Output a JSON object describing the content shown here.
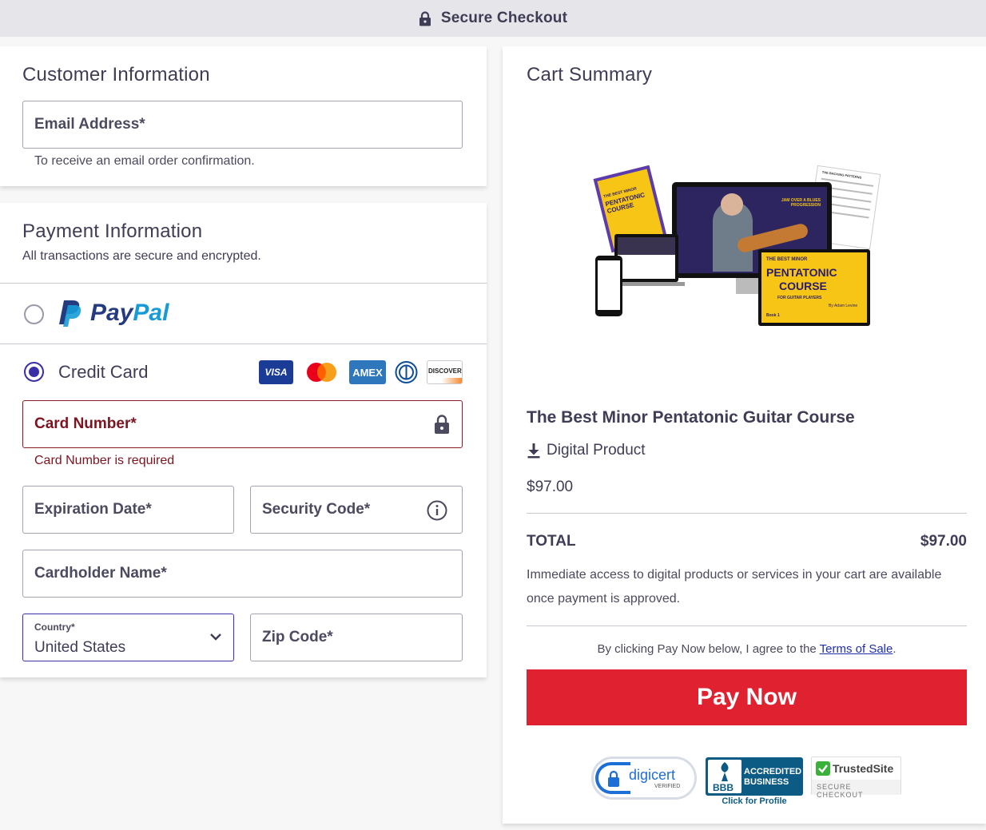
{
  "topbar": {
    "title": "Secure Checkout",
    "icon": "lock-icon"
  },
  "customer": {
    "heading": "Customer Information",
    "email_placeholder": "Email Address*",
    "email_note": "To receive an email order confirmation."
  },
  "payment": {
    "heading": "Payment Information",
    "subheading": "All transactions are secure and encrypted.",
    "paypal_label": "PayPal",
    "credit_card_label": "Credit Card",
    "selected_method": "credit-card",
    "card_logos": [
      "VISA",
      "mastercard",
      "AMEX",
      "diners",
      "DISCOVER"
    ],
    "card_number_placeholder": "Card Number*",
    "card_number_error": "Card Number is required",
    "expiration_placeholder": "Expiration Date*",
    "security_code_placeholder": "Security Code*",
    "cardholder_placeholder": "Cardholder Name*",
    "country_label": "Country*",
    "country_value": "United States",
    "zip_placeholder": "Zip Code*"
  },
  "cart": {
    "heading": "Cart Summary",
    "product_image": {
      "book_left_title": "PENTATONIC COURSE",
      "book_left_kicker": "THE BEST MINOR",
      "screen_text": "JAM OVER A BLUES PROGRESSION",
      "book_front_kicker": "THE BEST MINOR",
      "book_front_title1": "PENTATONIC",
      "book_front_title2": "COURSE",
      "book_front_sub": "FOR GUITAR PLAYERS",
      "book_front_author": "By Adam Levine",
      "book_front_vol": "Book 1",
      "sheet_title": "THE BACKING PATTERNS"
    },
    "product_name": "The Best Minor Pentatonic Guitar Course",
    "product_type": "Digital Product",
    "product_price": "$97.00",
    "total_label": "TOTAL",
    "total_value": "$97.00",
    "access_note": "Immediate access to digital products or services in your cart are available once payment is approved.",
    "terms_prefix": "By clicking Pay Now below, I agree to the ",
    "terms_link": "Terms of Sale",
    "terms_suffix": ".",
    "pay_button": "Pay Now",
    "badges": {
      "digicert": "digicert",
      "digicert_sub": "VERIFIED",
      "bbb_line1": "ACCREDITED",
      "bbb_line2": "BUSINESS",
      "bbb_logo": "BBB",
      "bbb_caption": "Click for Profile",
      "trusted_name": "TrustedSite",
      "trusted_sub": "SECURE CHECKOUT"
    }
  },
  "colors": {
    "accent": "#3b2fa8",
    "error": "#7d1421",
    "pay_button": "#e0212f",
    "heading": "#3f3d56"
  }
}
